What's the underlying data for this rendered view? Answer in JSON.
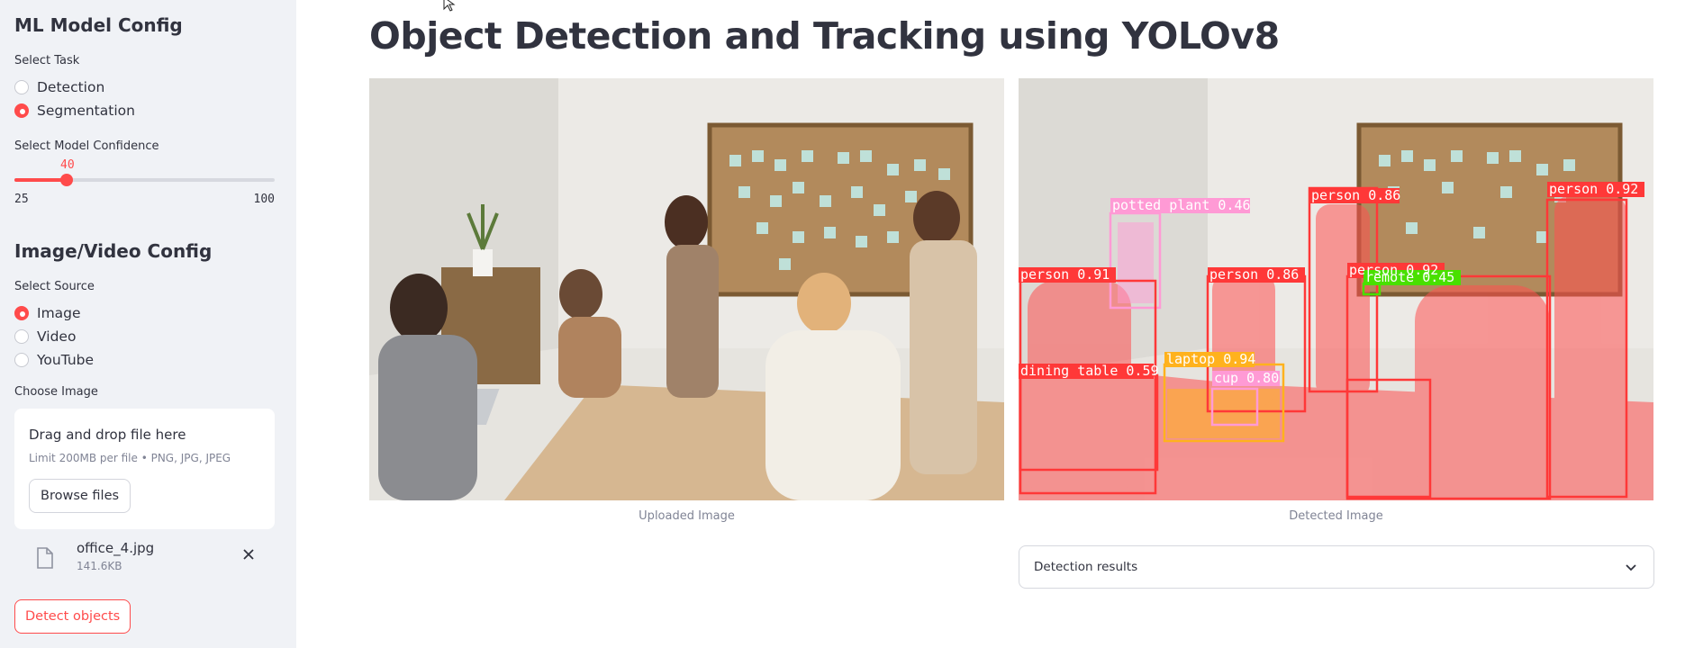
{
  "sidebar": {
    "model_config_title": "ML Model Config",
    "task_label": "Select Task",
    "task_options": [
      "Detection",
      "Segmentation"
    ],
    "task_selected": "Segmentation",
    "confidence_label": "Select Model Confidence",
    "confidence": {
      "value": "40",
      "min": "25",
      "max": "100"
    },
    "image_video_title": "Image/Video Config",
    "source_label": "Select Source",
    "source_options": [
      "Image",
      "Video",
      "YouTube"
    ],
    "source_selected": "Image",
    "choose_image_label": "Choose Image",
    "uploader": {
      "drag_text": "Drag and drop file here",
      "limit_text": "Limit 200MB per file • PNG, JPG, JPEG",
      "browse_label": "Browse files"
    },
    "file": {
      "name": "office_4.jpg",
      "size": "141.6KB"
    },
    "detect_button": "Detect objects"
  },
  "main": {
    "title": "Object Detection and Tracking using YOLOv8",
    "uploaded_caption": "Uploaded Image",
    "detected_caption": "Detected Image",
    "results_expander": "Detection results"
  },
  "detections": [
    {
      "label": "potted plant 0.46",
      "color": "#ff9ad5"
    },
    {
      "label": "person 0.86",
      "color": "#ff3838"
    },
    {
      "label": "person 0.92",
      "color": "#ff3838"
    },
    {
      "label": "person 0.91",
      "color": "#ff3838"
    },
    {
      "label": "person 0.86",
      "color": "#ff3838"
    },
    {
      "label": "person 0.92",
      "color": "#ff3838"
    },
    {
      "label": "remote 0.45",
      "color": "#49e000"
    },
    {
      "label": "laptop 0.94",
      "color": "#ffb21d"
    },
    {
      "label": "cup 0.80",
      "color": "#ff9ad5"
    },
    {
      "label": "dining table 0.59",
      "color": "#ff3838"
    }
  ],
  "colors": {
    "accent": "#ff4b4b",
    "sidebar_bg": "#f0f2f6",
    "text": "#31333f",
    "muted": "#808495"
  }
}
